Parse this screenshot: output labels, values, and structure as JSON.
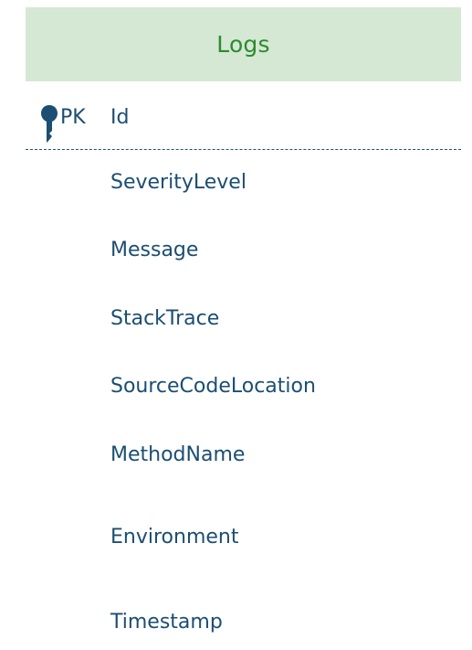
{
  "entity": {
    "title": "Logs",
    "primary_key": {
      "marker": "PK",
      "name": "Id",
      "icon": "key-icon"
    },
    "fields": [
      "SeverityLevel",
      "Message",
      "StackTrace",
      "SourceCodeLocation",
      "MethodName",
      "Environment",
      "Timestamp"
    ]
  },
  "colors": {
    "header_bg": "#d5e8d4",
    "title": "#2e8b2e",
    "text": "#1b4e72",
    "divider": "#1f4e8c"
  }
}
